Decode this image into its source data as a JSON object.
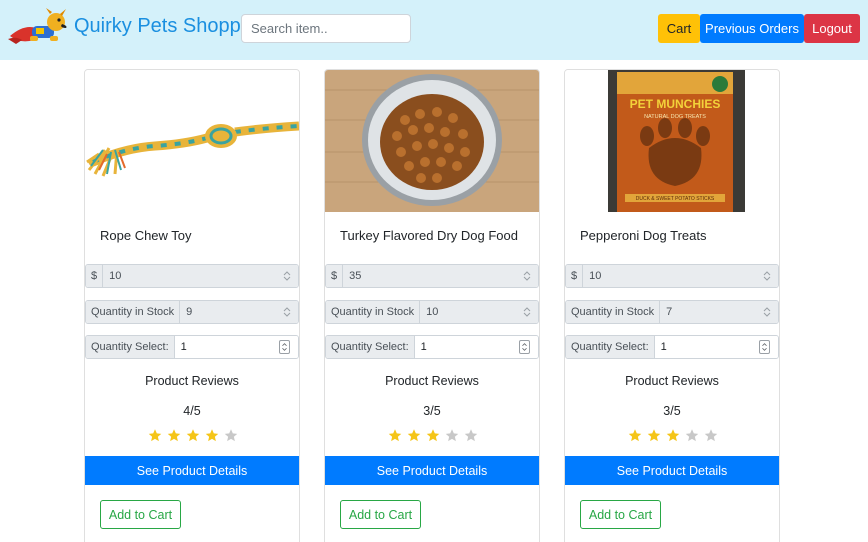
{
  "header": {
    "brand": "Quirky Pets Shoppe",
    "search_placeholder": "Search item..",
    "cart_label": "Cart",
    "orders_label": "Previous Orders",
    "logout_label": "Logout"
  },
  "products": [
    {
      "name": "Rope Chew Toy",
      "currency": "$",
      "price": "10",
      "stock_label": "Quantity in Stock",
      "stock": "9",
      "qty_label": "Quantity Select:",
      "qty": "1",
      "reviews_label": "Product Reviews",
      "rating_text": "4/5",
      "rating": 4,
      "details_label": "See Product Details",
      "add_label": "Add to Cart"
    },
    {
      "name": "Turkey Flavored Dry Dog Food",
      "currency": "$",
      "price": "35",
      "stock_label": "Quantity in Stock",
      "stock": "10",
      "qty_label": "Quantity Select:",
      "qty": "1",
      "reviews_label": "Product Reviews",
      "rating_text": "3/5",
      "rating": 3,
      "details_label": "See Product Details",
      "add_label": "Add to Cart"
    },
    {
      "name": "Pepperoni Dog Treats",
      "currency": "$",
      "price": "10",
      "stock_label": "Quantity in Stock",
      "stock": "7",
      "qty_label": "Quantity Select:",
      "qty": "1",
      "reviews_label": "Product Reviews",
      "rating_text": "3/5",
      "rating": 3,
      "details_label": "See Product Details",
      "add_label": "Add to Cart",
      "package_text": "PET MUNCHIES",
      "package_subtext": "NATURAL DOG TREATS",
      "package_flavor": "DUCK & SWEET POTATO STICKS"
    }
  ],
  "colors": {
    "navbar_bg": "#d4f1fa",
    "brand": "#1a8fe0",
    "primary": "#007bff",
    "warning": "#ffc107",
    "danger": "#dc3545",
    "success": "#28a745",
    "star_filled": "#f5c518",
    "star_empty": "#c8c8c8"
  }
}
